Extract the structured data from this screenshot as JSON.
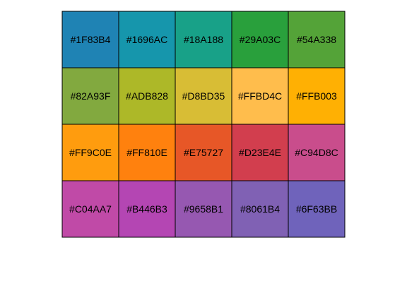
{
  "chart_data": {
    "type": "table",
    "rows": 4,
    "columns": 5,
    "cells": [
      [
        "#1F83B4",
        "#1696AC",
        "#18A188",
        "#29A03C",
        "#54A338"
      ],
      [
        "#82A93F",
        "#ADB828",
        "#D8BD35",
        "#FFBD4C",
        "#FFB003"
      ],
      [
        "#FF9C0E",
        "#FF810E",
        "#E75727",
        "#D23E4E",
        "#C94D8C"
      ],
      [
        "#C04AA7",
        "#B446B3",
        "#9658B1",
        "#8061B4",
        "#6F63BB"
      ]
    ],
    "grid": true,
    "border_color": "#000000"
  }
}
